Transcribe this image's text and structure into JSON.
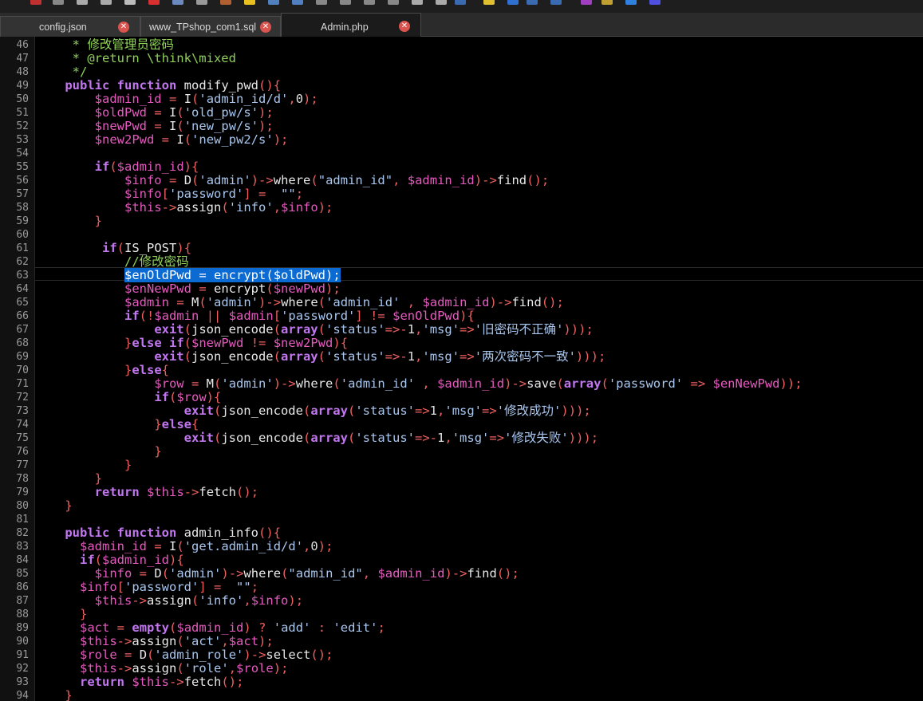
{
  "tabs": [
    {
      "label": "config.json",
      "active": false
    },
    {
      "label": "www_TPshop_com1.sql",
      "active": false
    },
    {
      "label": "Admin.php",
      "active": true
    }
  ],
  "editor": {
    "selected_line": 63,
    "lines": [
      {
        "n": "46",
        "t": "     * 修改管理员密码"
      },
      {
        "n": "47",
        "t": "     * @return \\think\\mixed"
      },
      {
        "n": "48",
        "t": "     */"
      },
      {
        "n": "49",
        "t": "    public function modify_pwd(){"
      },
      {
        "n": "50",
        "t": "        $admin_id = I('admin_id/d',0);"
      },
      {
        "n": "51",
        "t": "        $oldPwd = I('old_pw/s');"
      },
      {
        "n": "52",
        "t": "        $newPwd = I('new_pw/s');"
      },
      {
        "n": "53",
        "t": "        $new2Pwd = I('new_pw2/s');"
      },
      {
        "n": "54",
        "t": ""
      },
      {
        "n": "55",
        "t": "        if($admin_id){"
      },
      {
        "n": "56",
        "t": "            $info = D('admin')->where(\"admin_id\", $admin_id)->find();"
      },
      {
        "n": "57",
        "t": "            $info['password'] =  \"\";"
      },
      {
        "n": "58",
        "t": "            $this->assign('info',$info);"
      },
      {
        "n": "59",
        "t": "        }"
      },
      {
        "n": "60",
        "t": ""
      },
      {
        "n": "61",
        "t": "         if(IS_POST){"
      },
      {
        "n": "62",
        "t": "            //修改密码"
      },
      {
        "n": "63",
        "t": "            $enOldPwd = encrypt($oldPwd);"
      },
      {
        "n": "64",
        "t": "            $enNewPwd = encrypt($newPwd);"
      },
      {
        "n": "65",
        "t": "            $admin = M('admin')->where('admin_id' , $admin_id)->find();"
      },
      {
        "n": "66",
        "t": "            if(!$admin || $admin['password'] != $enOldPwd){"
      },
      {
        "n": "67",
        "t": "                exit(json_encode(array('status'=>-1,'msg'=>'旧密码不正确')));"
      },
      {
        "n": "68",
        "t": "            }else if($newPwd != $new2Pwd){"
      },
      {
        "n": "69",
        "t": "                exit(json_encode(array('status'=>-1,'msg'=>'两次密码不一致')));"
      },
      {
        "n": "70",
        "t": "            }else{"
      },
      {
        "n": "71",
        "t": "                $row = M('admin')->where('admin_id' , $admin_id)->save(array('password' => $enNewPwd));"
      },
      {
        "n": "72",
        "t": "                if($row){"
      },
      {
        "n": "73",
        "t": "                    exit(json_encode(array('status'=>1,'msg'=>'修改成功')));"
      },
      {
        "n": "74",
        "t": "                }else{"
      },
      {
        "n": "75",
        "t": "                    exit(json_encode(array('status'=>-1,'msg'=>'修改失败')));"
      },
      {
        "n": "76",
        "t": "                }"
      },
      {
        "n": "77",
        "t": "            }"
      },
      {
        "n": "78",
        "t": "        }"
      },
      {
        "n": "79",
        "t": "        return $this->fetch();"
      },
      {
        "n": "80",
        "t": "    }"
      },
      {
        "n": "81",
        "t": ""
      },
      {
        "n": "82",
        "t": "    public function admin_info(){"
      },
      {
        "n": "83",
        "t": "      $admin_id = I('get.admin_id/d',0);"
      },
      {
        "n": "84",
        "t": "      if($admin_id){"
      },
      {
        "n": "85",
        "t": "        $info = D('admin')->where(\"admin_id\", $admin_id)->find();"
      },
      {
        "n": "86",
        "t": "      $info['password'] =  \"\";"
      },
      {
        "n": "87",
        "t": "        $this->assign('info',$info);"
      },
      {
        "n": "88",
        "t": "      }"
      },
      {
        "n": "89",
        "t": "      $act = empty($admin_id) ? 'add' : 'edit';"
      },
      {
        "n": "90",
        "t": "      $this->assign('act',$act);"
      },
      {
        "n": "91",
        "t": "      $role = D('admin_role')->select();"
      },
      {
        "n": "92",
        "t": "      $this->assign('role',$role);"
      },
      {
        "n": "93",
        "t": "      return $this->fetch();"
      },
      {
        "n": "94",
        "t": "    }"
      }
    ]
  },
  "colors": {
    "background": "#000000",
    "keyword": "#c277f0",
    "variable": "#e65ac0",
    "string": "#a8c6ee",
    "comment": "#8fd05a",
    "selection": "#0b6bd3",
    "tab_close": "#d9534f"
  }
}
